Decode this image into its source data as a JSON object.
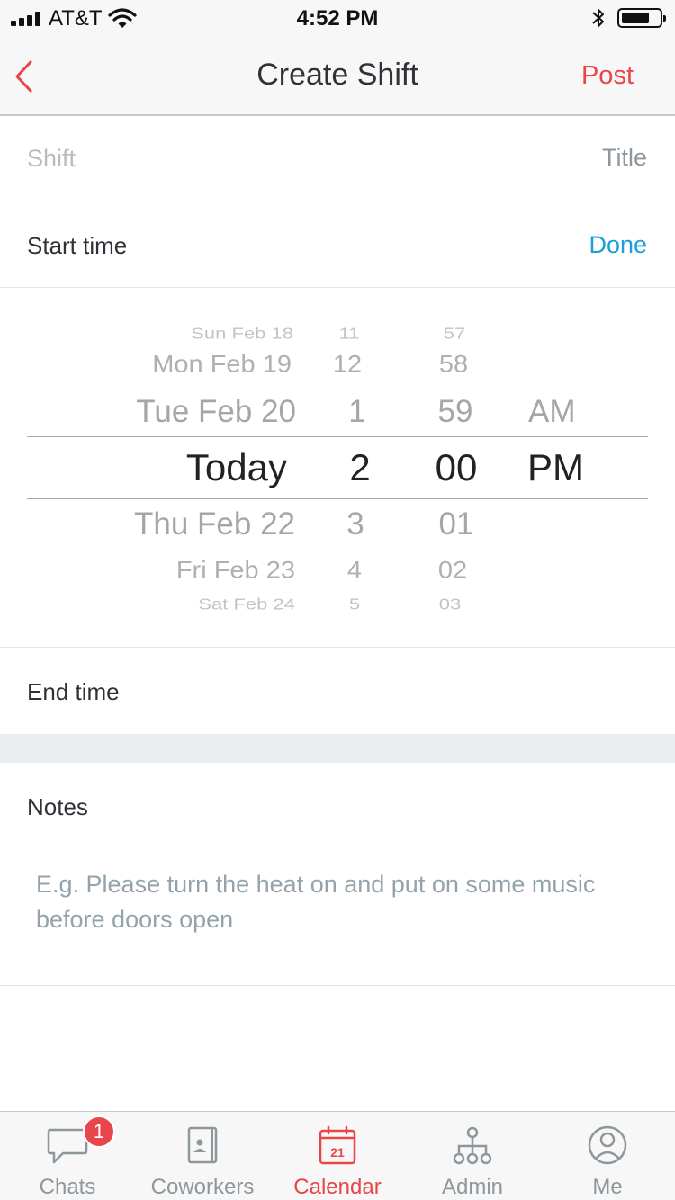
{
  "status_bar": {
    "carrier": "AT&T",
    "time": "4:52 PM"
  },
  "nav": {
    "title": "Create Shift",
    "post_label": "Post",
    "back_icon": "chevron-left-icon"
  },
  "shift_row": {
    "placeholder": "Shift",
    "right_label": "Title"
  },
  "start_row": {
    "label": "Start time",
    "done_label": "Done"
  },
  "picker": {
    "day": [
      "Sun Feb 18",
      "Mon Feb 19",
      "Tue Feb 20",
      "Today",
      "Thu Feb 22",
      "Fri Feb 23",
      "Sat Feb 24"
    ],
    "hour": [
      "11",
      "12",
      "1",
      "2",
      "3",
      "4",
      "5"
    ],
    "minute": [
      "57",
      "58",
      "59",
      "00",
      "01",
      "02",
      "03"
    ],
    "period": [
      "AM",
      "PM"
    ],
    "selected": {
      "day": "Today",
      "hour": "2",
      "minute": "00",
      "period": "PM"
    }
  },
  "end_row": {
    "label": "End time"
  },
  "notes": {
    "label": "Notes",
    "placeholder": "E.g. Please turn the heat on and put on some music before doors open"
  },
  "tabs": [
    {
      "label": "Chats",
      "icon": "chat-bubble-icon",
      "badge": "1"
    },
    {
      "label": "Coworkers",
      "icon": "contacts-book-icon"
    },
    {
      "label": "Calendar",
      "icon": "calendar-icon",
      "icon_text": "21",
      "active": true
    },
    {
      "label": "Admin",
      "icon": "org-chart-icon"
    },
    {
      "label": "Me",
      "icon": "user-circle-icon"
    }
  ],
  "colors": {
    "accent_red": "#e8464a",
    "done_blue": "#1c9fd8",
    "inactive_tab": "#8d979c"
  }
}
